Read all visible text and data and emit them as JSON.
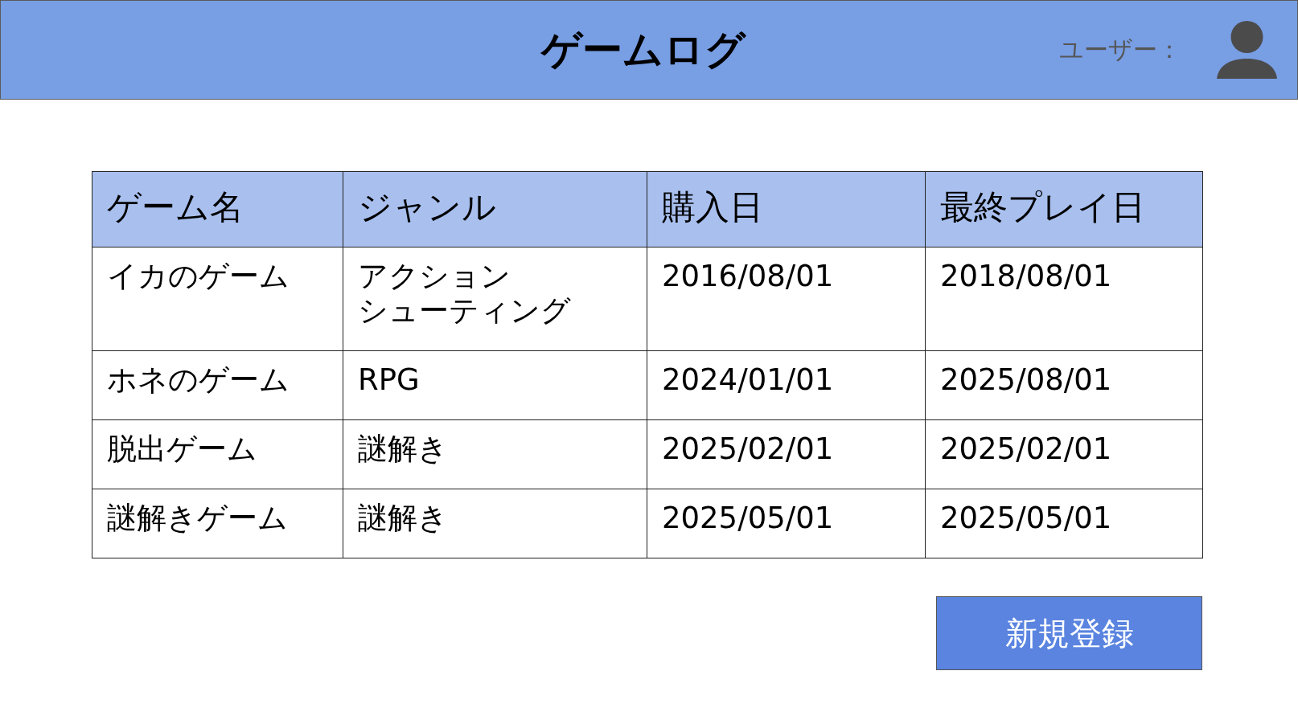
{
  "header": {
    "title": "ゲームログ",
    "user_label": "ユーザー："
  },
  "table": {
    "columns": [
      "ゲーム名",
      "ジャンル",
      "購入日",
      "最終プレイ日"
    ],
    "rows": [
      [
        "イカのゲーム",
        [
          "アクション",
          "シューティング"
        ],
        "2016/08/01",
        "2018/08/01"
      ],
      [
        "ホネのゲーム",
        "RPG",
        "2024/01/01",
        "2025/08/01"
      ],
      [
        "脱出ゲーム",
        "謎解き",
        "2025/02/01",
        "2025/02/01"
      ],
      [
        "謎解きゲーム",
        "謎解き",
        "2025/05/01",
        "2025/05/01"
      ]
    ]
  },
  "buttons": [
    "新規登録"
  ]
}
